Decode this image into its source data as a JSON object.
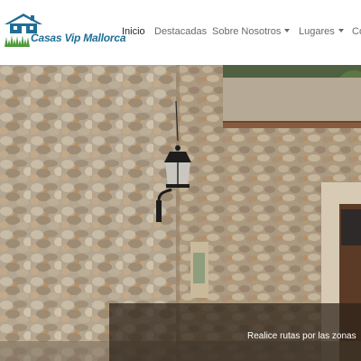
{
  "brand": {
    "name": "Casas Vip Mallorca",
    "logo_icon": "house-logo-icon",
    "accent": "#1f6e96",
    "grass_color": "#4d9a3a"
  },
  "nav": {
    "items": [
      {
        "label": "Inicio",
        "active": true,
        "dropdown": false
      },
      {
        "label": "Destacadas",
        "active": false,
        "dropdown": false
      },
      {
        "label": "Sobre Nosotros",
        "active": false,
        "dropdown": true
      },
      {
        "label": "Lugares",
        "active": false,
        "dropdown": true
      },
      {
        "label": "Co",
        "active": false,
        "dropdown": false
      }
    ],
    "active_color": "#262626",
    "inactive_color": "#6a6a6a"
  },
  "hero": {
    "caption": "Realice rutas por las zonas",
    "caption_band_color": "rgba(45,35,25,0.72)"
  }
}
